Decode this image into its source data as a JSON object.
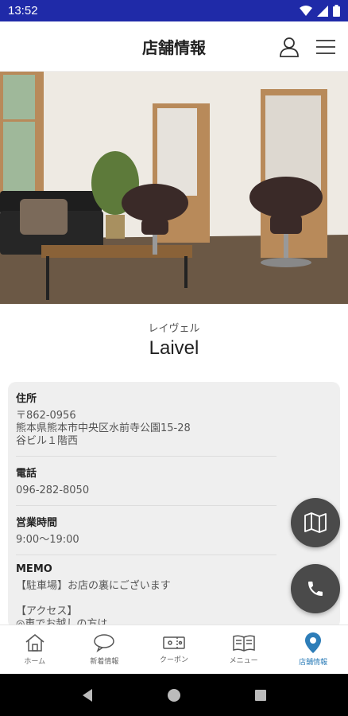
{
  "status": {
    "time": "13:52"
  },
  "header": {
    "title": "店舗情報"
  },
  "store": {
    "kana": "レイヴェル",
    "name": "Laivel"
  },
  "info": {
    "address_label": "住所",
    "address_lines": [
      "〒862-0956",
      "熊本県熊本市中央区水前寺公園15-28",
      "谷ビル１階西"
    ],
    "phone_label": "電話",
    "phone": "096-282-8050",
    "hours_label": "営業時間",
    "hours": "9:00〜19:00",
    "memo_label": "MEMO",
    "memo_lines": [
      "【駐車場】お店の裏にございます",
      "",
      "【アクセス】",
      "◎車でお越しの方は"
    ]
  },
  "nav": {
    "items": [
      {
        "label": "ホーム",
        "icon": "home-icon"
      },
      {
        "label": "新着情報",
        "icon": "chat-bubble-icon"
      },
      {
        "label": "クーポン",
        "icon": "coupon-icon"
      },
      {
        "label": "メニュー",
        "icon": "book-icon"
      },
      {
        "label": "店舗情報",
        "icon": "map-pin-icon"
      }
    ],
    "active_index": 4
  },
  "colors": {
    "status_bar": "#1f2aa8",
    "accent": "#2d7db8",
    "fab": "#4a4a4a"
  }
}
